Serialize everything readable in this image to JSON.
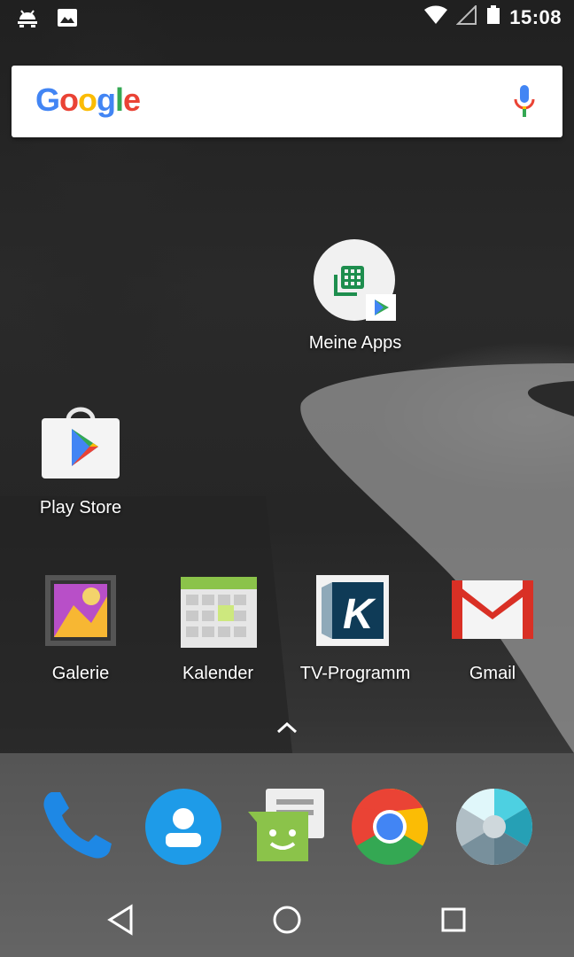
{
  "status_bar": {
    "time": "15:08",
    "left_icons": [
      "android-debug-icon",
      "image-notification-icon"
    ],
    "right_icons": [
      "wifi-icon",
      "cell-signal-icon",
      "battery-icon"
    ]
  },
  "search": {
    "logo_text": "Google",
    "brand_colors": [
      "#4285F4",
      "#EA4335",
      "#FBBC05",
      "#4285F4",
      "#34A853",
      "#EA4335"
    ]
  },
  "apps": {
    "meine_apps": "Meine Apps",
    "play_store": "Play Store",
    "galerie": "Galerie",
    "kalender": "Kalender",
    "tv_programm": "TV-Programm",
    "gmail": "Gmail"
  },
  "dock": {
    "items": [
      "phone-icon",
      "contacts-icon",
      "messaging-icon",
      "chrome-icon",
      "camera-icon"
    ]
  },
  "nav": {
    "buttons": [
      "back-button",
      "home-button",
      "recents-button"
    ]
  }
}
